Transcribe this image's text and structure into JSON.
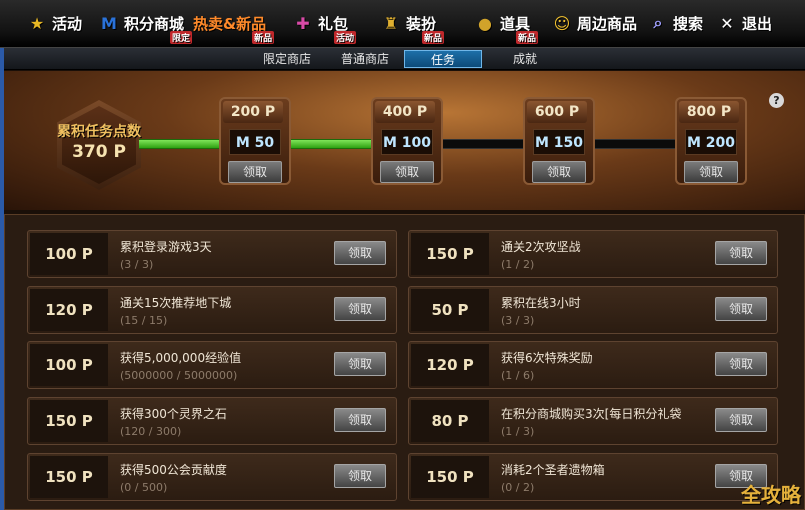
{
  "topnav": [
    {
      "label": "活动",
      "sub": "",
      "icon": "star-icon",
      "color": "#e8b824"
    },
    {
      "label": "积分商城",
      "sub": "限定",
      "icon": "m-logo-icon",
      "color": "#2a72d9"
    },
    {
      "label": "热卖&新品",
      "sub": "新品",
      "icon": "hot-icon",
      "color": "#ff8a2a"
    },
    {
      "label": "礼包",
      "sub": "活动",
      "icon": "gift-icon",
      "color": "#d84aa7"
    },
    {
      "label": "装扮",
      "sub": "新品",
      "icon": "trophy-icon",
      "color": "#e0b030"
    },
    {
      "label": "道具",
      "sub": "新品",
      "icon": "coin-icon",
      "color": "#d1a32a"
    },
    {
      "label": "周边商品",
      "sub": "",
      "icon": "smiley-icon",
      "color": "#f2c230"
    },
    {
      "label": "搜索",
      "sub": "",
      "icon": "search-icon",
      "color": "#a0a0ff"
    },
    {
      "label": "退出",
      "sub": "",
      "icon": "close-icon",
      "color": "#ffffff"
    }
  ],
  "tabs": [
    {
      "label": "限定商店",
      "active": false
    },
    {
      "label": "普通商店",
      "active": false
    },
    {
      "label": "任务",
      "active": true
    },
    {
      "label": "成就",
      "active": false
    }
  ],
  "summary": {
    "label": "累积任务点数",
    "value": "370 P"
  },
  "milestones": [
    {
      "points": "200 P",
      "reward": "M 50",
      "button": "领取"
    },
    {
      "points": "400 P",
      "reward": "M 100",
      "button": "领取"
    },
    {
      "points": "600 P",
      "reward": "M 150",
      "button": "领取"
    },
    {
      "points": "800 P",
      "reward": "M 200",
      "button": "领取"
    }
  ],
  "help": "?",
  "tasks": [
    {
      "points": "100 P",
      "title": "累积登录游戏3天",
      "progress": "(3 / 3)",
      "button": "领取"
    },
    {
      "points": "150 P",
      "title": "通关2次攻坚战",
      "progress": "(1 / 2)",
      "button": "领取"
    },
    {
      "points": "120 P",
      "title": "通关15次推荐地下城",
      "progress": "(15 / 15)",
      "button": "领取"
    },
    {
      "points": "50 P",
      "title": "累积在线3小时",
      "progress": "(3 / 3)",
      "button": "领取"
    },
    {
      "points": "100 P",
      "title": "获得5,000,000经验值",
      "progress": "(5000000 / 5000000)",
      "button": "领取"
    },
    {
      "points": "120 P",
      "title": "获得6次特殊奖励",
      "progress": "(1 / 6)",
      "button": "领取"
    },
    {
      "points": "150 P",
      "title": "获得300个灵界之石",
      "progress": "(120 / 300)",
      "button": "领取"
    },
    {
      "points": "80 P",
      "title": "在积分商城购买3次[每日积分礼袋",
      "progress": "(1 / 3)",
      "button": "领取"
    },
    {
      "points": "150 P",
      "title": "获得500公会贡献度",
      "progress": "(0 / 500)",
      "button": "领取"
    },
    {
      "points": "150 P",
      "title": "消耗2个圣者遗物箱",
      "progress": "(0 / 2)",
      "button": "领取"
    }
  ],
  "watermark": "全攻略"
}
